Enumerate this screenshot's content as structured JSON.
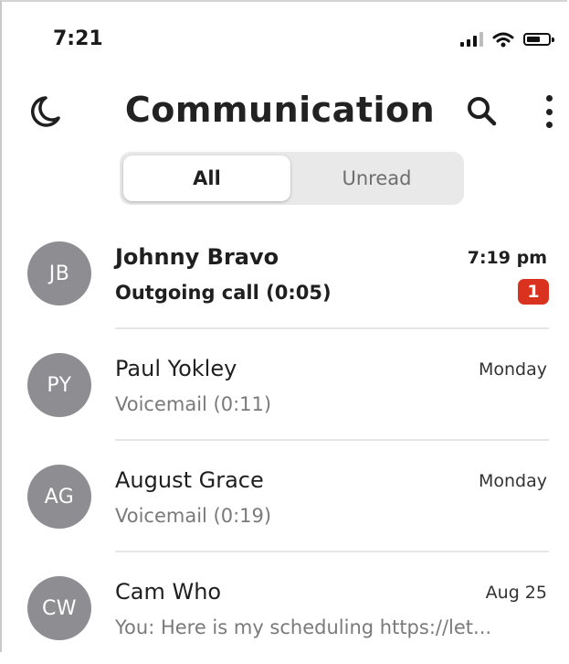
{
  "status_bar": {
    "time": "7:21",
    "icons": [
      "signal-icon",
      "wifi-icon",
      "battery-icon"
    ]
  },
  "header": {
    "title": "Communication",
    "left_icon": "moon-icon",
    "right_icons": [
      "search-icon",
      "more-vertical-icon"
    ]
  },
  "filter": {
    "options": [
      {
        "label": "All",
        "selected": true
      },
      {
        "label": "Unread",
        "selected": false
      }
    ]
  },
  "conversations": [
    {
      "initials": "JB",
      "name": "Johnny Bravo",
      "subtitle": "Outgoing call (0:05)",
      "time": "7:19 pm",
      "unread_count": "1",
      "unread": true
    },
    {
      "initials": "PY",
      "name": "Paul Yokley",
      "subtitle": "Voicemail (0:11)",
      "time": "Monday",
      "unread": false
    },
    {
      "initials": "AG",
      "name": "August Grace",
      "subtitle": "Voicemail (0:19)",
      "time": "Monday",
      "unread": false
    },
    {
      "initials": "CW",
      "name": "Cam Who",
      "subtitle": "You: Here is my scheduling https://let...",
      "time": "Aug 25",
      "unread": false
    }
  ],
  "colors": {
    "avatar": "#8d8d92",
    "badge": "#d9331f",
    "segment_bg": "#e9e9ea",
    "text": "#1f1f1f",
    "secondary_text": "#7a7a7a"
  }
}
